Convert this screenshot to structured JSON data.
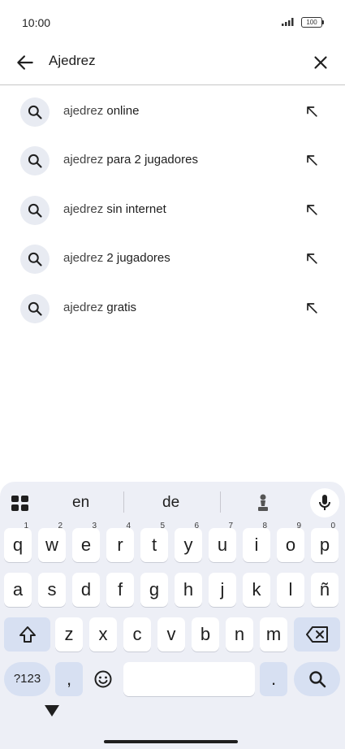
{
  "status_bar": {
    "time": "10:00",
    "battery": "100"
  },
  "search": {
    "query": "Ajedrez"
  },
  "suggestions": [
    {
      "prefix": "ajedrez",
      "rest": " online"
    },
    {
      "prefix": "ajedrez",
      "rest": " para 2 jugadores"
    },
    {
      "prefix": "ajedrez",
      "rest": " sin internet"
    },
    {
      "prefix": "ajedrez",
      "rest": " 2 jugadores"
    },
    {
      "prefix": "ajedrez",
      "rest": " gratis"
    }
  ],
  "keyboard": {
    "suggestion_words": [
      "en",
      "de"
    ],
    "row1": [
      {
        "k": "q",
        "s": "1"
      },
      {
        "k": "w",
        "s": "2"
      },
      {
        "k": "e",
        "s": "3"
      },
      {
        "k": "r",
        "s": "4"
      },
      {
        "k": "t",
        "s": "5"
      },
      {
        "k": "y",
        "s": "6"
      },
      {
        "k": "u",
        "s": "7"
      },
      {
        "k": "i",
        "s": "8"
      },
      {
        "k": "o",
        "s": "9"
      },
      {
        "k": "p",
        "s": "0"
      }
    ],
    "row2": [
      "a",
      "s",
      "d",
      "f",
      "g",
      "h",
      "j",
      "k",
      "l",
      "ñ"
    ],
    "row3": [
      "z",
      "x",
      "c",
      "v",
      "b",
      "n",
      "m"
    ],
    "symbols_label": "?123",
    "comma": ",",
    "period": "."
  }
}
